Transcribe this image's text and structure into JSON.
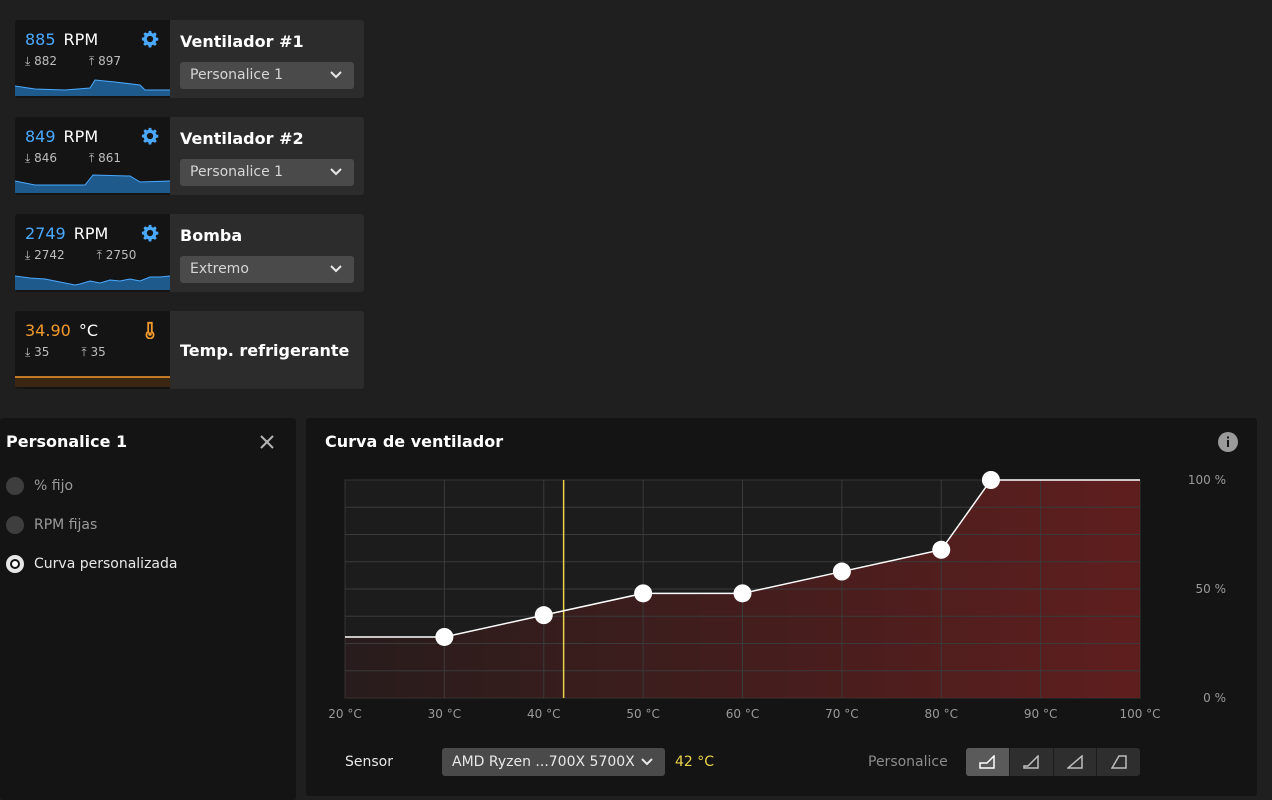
{
  "cards": [
    {
      "value": "885",
      "unit": "RPM",
      "min": "882",
      "max": "897",
      "name": "Ventilador #1",
      "mode": "Personalice 1",
      "icon": "gear-icon",
      "accent": "#4aa9ff"
    },
    {
      "value": "849",
      "unit": "RPM",
      "min": "846",
      "max": "861",
      "name": "Ventilador #2",
      "mode": "Personalice 1",
      "icon": "gear-icon",
      "accent": "#4aa9ff"
    },
    {
      "value": "2749",
      "unit": "RPM",
      "min": "2742",
      "max": "2750",
      "name": "Bomba",
      "mode": "Extremo",
      "icon": "pump-gear-icon",
      "accent": "#4aa9ff"
    },
    {
      "value": "34.90",
      "unit": "°C",
      "min": "35",
      "max": "35",
      "name": "Temp. refrigerante",
      "icon": "thermometer-icon",
      "accent": "#f39a2d"
    }
  ],
  "left_panel": {
    "title": "Personalice 1",
    "options": [
      {
        "label": "% fijo",
        "selected": false
      },
      {
        "label": "RPM fijas",
        "selected": false
      },
      {
        "label": "Curva personalizada",
        "selected": true
      }
    ]
  },
  "curve_panel": {
    "title": "Curva de ventilador",
    "sensor_label": "Sensor",
    "sensor_value": "AMD Ryzen ...700X 5700X",
    "sensor_temp": "42 °C",
    "preset_label": "Personalice"
  },
  "chart_data": {
    "type": "line",
    "x": [
      20,
      30,
      40,
      50,
      60,
      70,
      80,
      85,
      100
    ],
    "y": [
      28,
      28,
      38,
      48,
      48,
      58,
      68,
      100,
      100
    ],
    "control_points": [
      [
        30,
        28
      ],
      [
        40,
        38
      ],
      [
        50,
        48
      ],
      [
        60,
        48
      ],
      [
        70,
        58
      ],
      [
        80,
        68
      ],
      [
        85,
        100
      ]
    ],
    "xlim": [
      20,
      100
    ],
    "ylim": [
      0,
      100
    ],
    "x_ticks": [
      "20 °C",
      "30 °C",
      "40 °C",
      "50 °C",
      "60 °C",
      "70 °C",
      "80 °C",
      "90 °C",
      "100 °C"
    ],
    "y_ticks": [
      "100 %",
      "50 %",
      "0 %"
    ],
    "current_temp": 42,
    "grid": true,
    "line_color": "#ffffff",
    "fill_color": "#6b1e1e",
    "marker_color": "#e8d24a"
  }
}
